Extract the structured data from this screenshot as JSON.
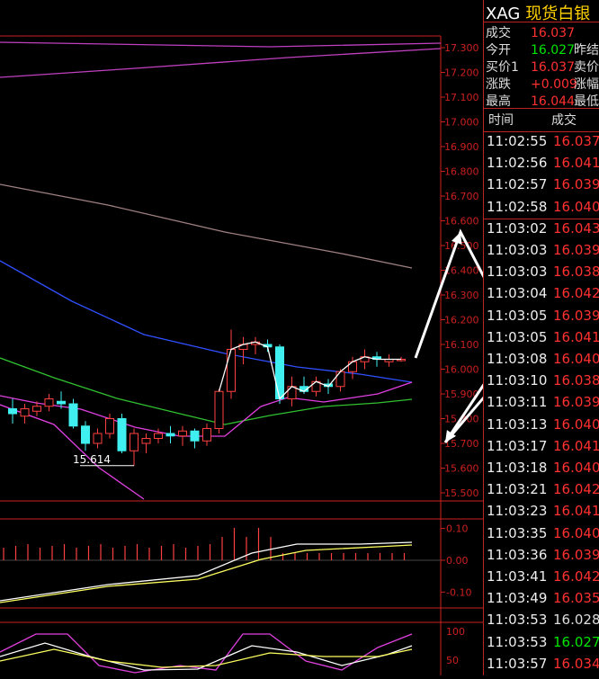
{
  "header": {
    "symbol": "XAG",
    "name": "现货白银"
  },
  "quote": {
    "rows": [
      {
        "label": "成交",
        "value": "16.037",
        "color": "#ff3030",
        "label2": ""
      },
      {
        "label": "今开",
        "value": "16.027",
        "color": "#00e600",
        "label2": "昨结"
      },
      {
        "label": "买价1",
        "value": "16.037",
        "color": "#ff3030",
        "label2": "卖价"
      },
      {
        "label": "涨跌",
        "value": "+0.009",
        "color": "#ff3030",
        "label2": "涨幅"
      },
      {
        "label": "最高",
        "value": "16.044",
        "color": "#ff3030",
        "label2": "最低"
      }
    ]
  },
  "ticks": {
    "header_time": "时间",
    "header_price": "成交",
    "rows": [
      {
        "time": "11:02:55",
        "price": "16.037",
        "color": "#ff3030"
      },
      {
        "time": "11:02:56",
        "price": "16.041",
        "color": "#ff3030"
      },
      {
        "time": "11:02:57",
        "price": "16.039",
        "color": "#ff3030"
      },
      {
        "time": "11:02:58",
        "price": "16.040",
        "color": "#ff3030"
      },
      {
        "time": "11:03:02",
        "price": "16.043",
        "color": "#ff3030"
      },
      {
        "time": "11:03:03",
        "price": "16.039",
        "color": "#ff3030"
      },
      {
        "time": "11:03:03",
        "price": "16.038",
        "color": "#ff3030"
      },
      {
        "time": "11:03:04",
        "price": "16.042",
        "color": "#ff3030"
      },
      {
        "time": "11:03:05",
        "price": "16.039",
        "color": "#ff3030"
      },
      {
        "time": "11:03:05",
        "price": "16.041",
        "color": "#ff3030"
      },
      {
        "time": "11:03:08",
        "price": "16.040",
        "color": "#ff3030"
      },
      {
        "time": "11:03:10",
        "price": "16.038",
        "color": "#ff3030"
      },
      {
        "time": "11:03:11",
        "price": "16.039",
        "color": "#ff3030"
      },
      {
        "time": "11:03:13",
        "price": "16.040",
        "color": "#ff3030"
      },
      {
        "time": "11:03:17",
        "price": "16.041",
        "color": "#ff3030"
      },
      {
        "time": "11:03:18",
        "price": "16.040",
        "color": "#ff3030"
      },
      {
        "time": "11:03:21",
        "price": "16.042",
        "color": "#ff3030"
      },
      {
        "time": "11:03:23",
        "price": "16.041",
        "color": "#ff3030"
      },
      {
        "time": "11:03:35",
        "price": "16.040",
        "color": "#ff3030"
      },
      {
        "time": "11:03:36",
        "price": "16.039",
        "color": "#ff3030"
      },
      {
        "time": "11:03:41",
        "price": "16.042",
        "color": "#ff3030"
      },
      {
        "time": "11:03:49",
        "price": "16.035",
        "color": "#ff3030"
      },
      {
        "time": "11:03:53",
        "price": "16.028",
        "color": "#dddddd"
      },
      {
        "time": "11:03:53",
        "price": "16.027",
        "color": "#00e600"
      },
      {
        "time": "11:03:57",
        "price": "16.034",
        "color": "#ff3030"
      }
    ]
  },
  "chart_data": {
    "type": "candlestick",
    "price_axis_labels": [
      "17.300",
      "17.200",
      "17.100",
      "17.000",
      "16.900",
      "16.800",
      "16.700",
      "16.600",
      "16.500",
      "16.400",
      "16.300",
      "16.200",
      "16.100",
      "16.000",
      "15.900",
      "15.800",
      "15.700",
      "15.600",
      "15.500"
    ],
    "price_range": [
      15.5,
      17.3
    ],
    "low_annotation": "15.614",
    "candles": [
      {
        "o": 15.84,
        "h": 15.88,
        "l": 15.78,
        "c": 15.82
      },
      {
        "o": 15.81,
        "h": 15.86,
        "l": 15.78,
        "c": 15.84
      },
      {
        "o": 15.83,
        "h": 15.87,
        "l": 15.81,
        "c": 15.85
      },
      {
        "o": 15.85,
        "h": 15.9,
        "l": 15.83,
        "c": 15.88
      },
      {
        "o": 15.87,
        "h": 15.91,
        "l": 15.84,
        "c": 15.86
      },
      {
        "o": 15.86,
        "h": 15.88,
        "l": 15.76,
        "c": 15.77
      },
      {
        "o": 15.77,
        "h": 15.79,
        "l": 15.67,
        "c": 15.7
      },
      {
        "o": 15.7,
        "h": 15.76,
        "l": 15.68,
        "c": 15.74
      },
      {
        "o": 15.74,
        "h": 15.82,
        "l": 15.72,
        "c": 15.8
      },
      {
        "o": 15.8,
        "h": 15.82,
        "l": 15.66,
        "c": 15.67
      },
      {
        "o": 15.67,
        "h": 15.76,
        "l": 15.61,
        "c": 15.74
      },
      {
        "o": 15.7,
        "h": 15.74,
        "l": 15.66,
        "c": 15.72
      },
      {
        "o": 15.72,
        "h": 15.76,
        "l": 15.7,
        "c": 15.74
      },
      {
        "o": 15.74,
        "h": 15.77,
        "l": 15.7,
        "c": 15.73
      },
      {
        "o": 15.73,
        "h": 15.77,
        "l": 15.69,
        "c": 15.75
      },
      {
        "o": 15.75,
        "h": 15.76,
        "l": 15.68,
        "c": 15.71
      },
      {
        "o": 15.71,
        "h": 15.78,
        "l": 15.69,
        "c": 15.76
      },
      {
        "o": 15.76,
        "h": 15.92,
        "l": 15.74,
        "c": 15.91
      },
      {
        "o": 15.91,
        "h": 16.16,
        "l": 15.88,
        "c": 16.08
      },
      {
        "o": 16.08,
        "h": 16.13,
        "l": 16.02,
        "c": 16.1
      },
      {
        "o": 16.1,
        "h": 16.13,
        "l": 16.06,
        "c": 16.11
      },
      {
        "o": 16.1,
        "h": 16.12,
        "l": 16.07,
        "c": 16.09
      },
      {
        "o": 16.09,
        "h": 16.1,
        "l": 15.86,
        "c": 15.88
      },
      {
        "o": 15.88,
        "h": 15.97,
        "l": 15.85,
        "c": 15.93
      },
      {
        "o": 15.93,
        "h": 15.97,
        "l": 15.9,
        "c": 15.91
      },
      {
        "o": 15.91,
        "h": 15.97,
        "l": 15.89,
        "c": 15.95
      },
      {
        "o": 15.94,
        "h": 15.96,
        "l": 15.9,
        "c": 15.93
      },
      {
        "o": 15.93,
        "h": 16.0,
        "l": 15.91,
        "c": 15.99
      },
      {
        "o": 15.99,
        "h": 16.05,
        "l": 15.96,
        "c": 16.03
      },
      {
        "o": 16.03,
        "h": 16.08,
        "l": 16.0,
        "c": 16.05
      },
      {
        "o": 16.05,
        "h": 16.07,
        "l": 16.01,
        "c": 16.04
      },
      {
        "o": 16.03,
        "h": 16.06,
        "l": 16.01,
        "c": 16.04
      },
      {
        "o": 16.04,
        "h": 16.05,
        "l": 16.03,
        "c": 16.04
      }
    ],
    "macd_axis_labels": [
      "0.10",
      "0.00",
      "-0.10"
    ],
    "macd_range": [
      -0.15,
      0.13
    ],
    "kdj_axis_labels": [
      "100",
      "50"
    ],
    "colors": {
      "up": "#ff4040",
      "down": "#40f0f0",
      "axis": "#cc2020"
    }
  }
}
